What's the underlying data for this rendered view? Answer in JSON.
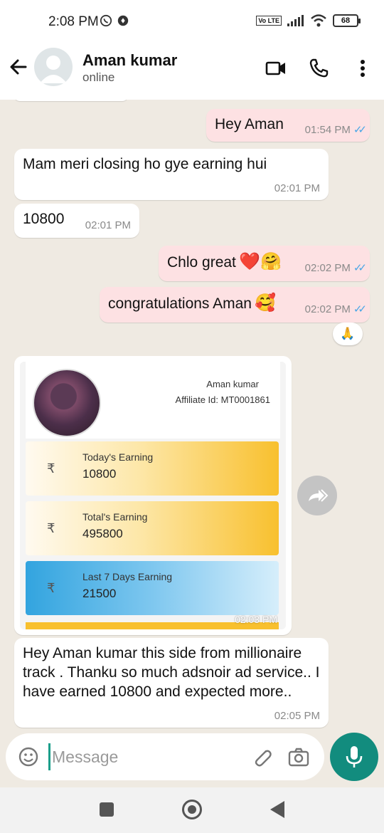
{
  "status_bar": {
    "time": "2:08 PM",
    "volte": "Vo LTE",
    "battery": "68"
  },
  "header": {
    "name": "Aman kumar",
    "status": "online"
  },
  "messages": [
    {
      "text": "Hey Aman",
      "time": "01:54 PM"
    },
    {
      "text": "Mam meri closing ho gye earning hui",
      "time": "02:01 PM"
    },
    {
      "text": "10800",
      "time": "02:01 PM"
    },
    {
      "text": "Chlo great",
      "emoji": "❤️🤗",
      "time": "02:02 PM"
    },
    {
      "text": "congratulations Aman",
      "emoji": "🥰",
      "time": "02:02 PM"
    },
    {
      "text": "Hey Aman kumar this side from millionaire track . Thanku so much adsnoir  ad service.. I have earned 10800 and expected more..",
      "time": "02:05 PM"
    }
  ],
  "reaction": "🙏",
  "image_card": {
    "name": "Aman kumar",
    "affiliate": "Affiliate Id: MT0001861",
    "currency": "₹",
    "earnings": [
      {
        "label": "Today's Earning",
        "value": "10800"
      },
      {
        "label": "Total's Earning",
        "value": "495800"
      },
      {
        "label": "Last 7 Days Earning",
        "value": "21500"
      }
    ],
    "time": "02:03 PM"
  },
  "input": {
    "placeholder": "Message"
  }
}
